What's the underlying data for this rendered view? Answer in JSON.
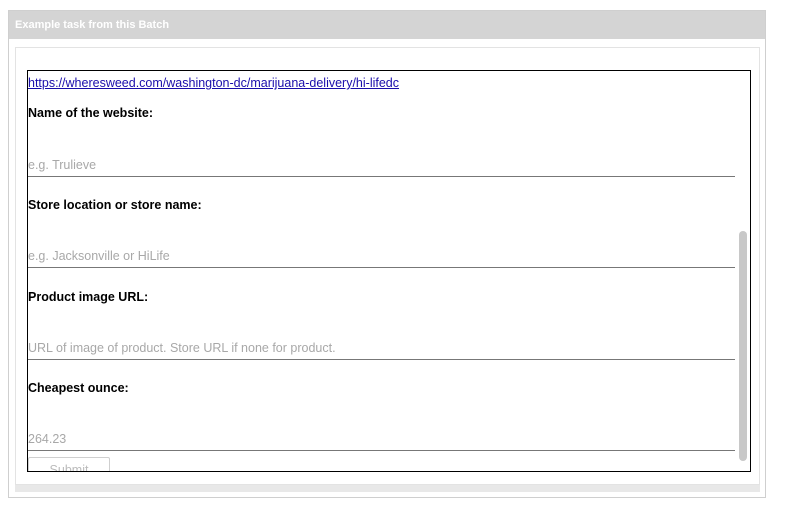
{
  "panel": {
    "title": "Example task from this Batch"
  },
  "task": {
    "link": "https://wheresweed.com/washington-dc/marijuana-delivery/hi-lifedc"
  },
  "fields": [
    {
      "label": "Name of the website:",
      "placeholder": "e.g. Trulieve",
      "value": ""
    },
    {
      "label": "Store location or store name:",
      "placeholder": "e.g. Jacksonville or HiLife",
      "value": ""
    },
    {
      "label": "Product image URL:",
      "placeholder": "URL of image of product. Store URL if none for product.",
      "value": ""
    },
    {
      "label": "Cheapest ounce:",
      "placeholder": "264.23",
      "value": ""
    }
  ],
  "submit": {
    "label": "Submit"
  }
}
